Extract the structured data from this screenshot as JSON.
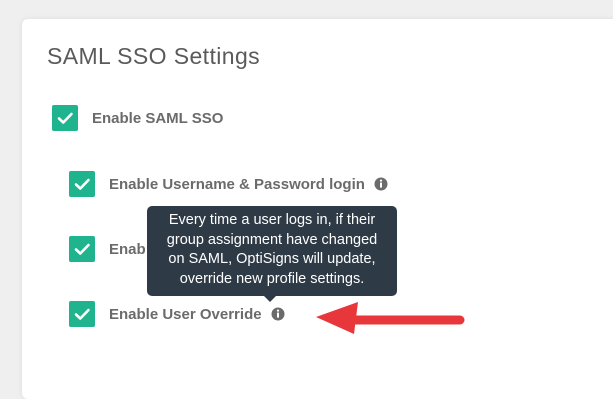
{
  "panel": {
    "title": "SAML SSO Settings"
  },
  "options": [
    {
      "label": "Enable SAML SSO",
      "checked": true,
      "has_info": false
    },
    {
      "label": "Enable Username & Password login",
      "checked": true,
      "has_info": true
    },
    {
      "label": "Enab",
      "checked": true,
      "has_info": false
    },
    {
      "label": "Enable User Override",
      "checked": true,
      "has_info": true
    }
  ],
  "tooltip": {
    "lines": [
      "Every time a user logs in, if their",
      "group assignment have changed",
      "on SAML, OptiSigns will update,",
      "override new profile settings."
    ]
  },
  "colors": {
    "accent": "#1fb38e",
    "tooltip_bg": "#2e3a46",
    "annotation_arrow": "#e8373a"
  },
  "icons": {
    "info": "info-circle-icon",
    "check": "check-icon"
  }
}
